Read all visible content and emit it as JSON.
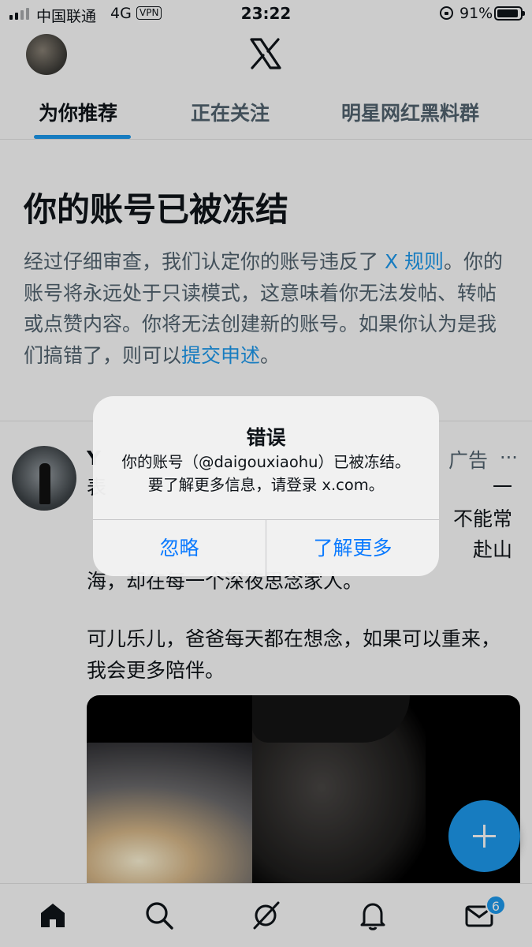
{
  "status_bar": {
    "carrier": "中国联通",
    "network": "4G",
    "vpn": "VPN",
    "time": "23:22",
    "battery": "91%"
  },
  "tabs": [
    {
      "label": "为你推荐",
      "active": true
    },
    {
      "label": "正在关注",
      "active": false
    },
    {
      "label": "明星网红黑料群",
      "active": false
    }
  ],
  "notice": {
    "title": "你的账号已被冻结",
    "body_part1": "经过仔细审查，我们认定你的账号违反了 ",
    "rules_link": "X 规则",
    "body_part2": "。你的账号将永远处于只读模式，这意味着你无法发帖、转帖或点赞内容。你将无法创建新的账号。如果你认为是我们搞错了，则可以",
    "appeal_link": "提交申述",
    "body_part3": "。"
  },
  "post": {
    "author_initial": "Y",
    "ad_label": "广告",
    "more_label": "···",
    "text_lines": [
      "表",
      "一",
      "不能常",
      "赴山",
      "海，却在每一个深夜思念家人。"
    ],
    "paragraph2": "可儿乐儿，爸爸每天都在想念，如果可以重来，我会更多陪伴。"
  },
  "alert": {
    "title": "错误",
    "message": "你的账号（@daigouxiaohu）已被冻结。要了解更多信息，请登录 x.com。",
    "ignore_label": "忽略",
    "learn_more_label": "了解更多"
  },
  "bottom_nav": {
    "items": [
      "home-icon",
      "search-icon",
      "grok-icon",
      "notifications-icon",
      "messages-icon"
    ],
    "messages_badge": "6"
  },
  "colors": {
    "accent": "#1d9bf0",
    "ios_blue": "#0a7aff",
    "secondary_text": "#536471"
  }
}
